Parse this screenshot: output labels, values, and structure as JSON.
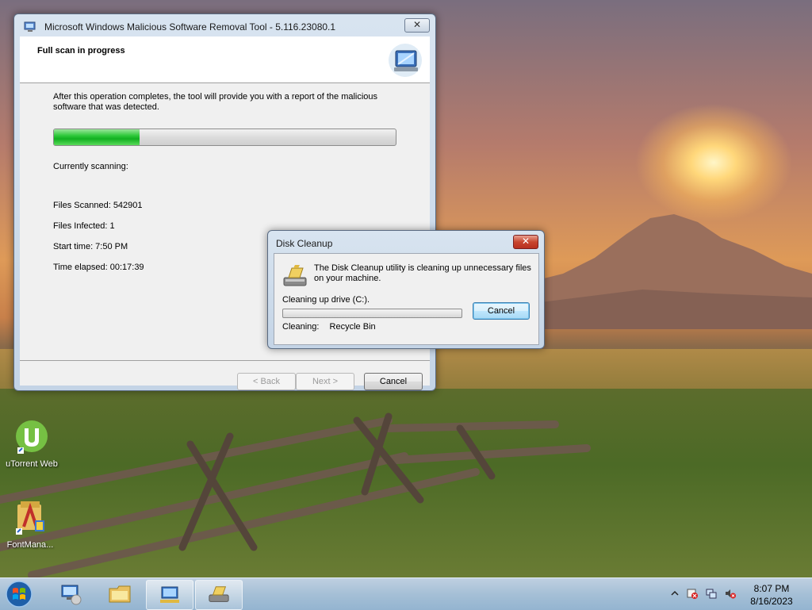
{
  "msrt": {
    "title": "Microsoft Windows Malicious Software Removal Tool - 5.116.23080.1",
    "close_symbol": "✕",
    "header_title": "Full scan in progress",
    "description": "After this operation completes, the tool will provide you with a report of the malicious software that was detected.",
    "progress_fraction": 0.25,
    "currently_scanning": "Currently scanning:",
    "files_scanned": "Files Scanned: 542901",
    "files_infected": "Files Infected: 1",
    "start_time": "Start time: 7:50 PM",
    "time_elapsed": "Time elapsed: 00:17:39",
    "back_label": "< Back",
    "next_label": "Next >",
    "cancel_label": "Cancel"
  },
  "disk_cleanup": {
    "title": "Disk Cleanup",
    "close_symbol": "✕",
    "message": "The Disk Cleanup utility is cleaning up unnecessary files on your machine.",
    "drive_text": "Cleaning up drive  (C:).",
    "cancel_label": "Cancel",
    "cleaning_label": "Cleaning:",
    "cleaning_item": "Recycle Bin",
    "progress_fraction": 0.0
  },
  "desktop": {
    "icons": [
      {
        "label": "uTorrent Web",
        "icon": "utorrent-icon"
      },
      {
        "label": "FontMana...",
        "icon": "font-manager-icon"
      }
    ]
  },
  "taskbar": {
    "time": "8:07 PM",
    "date": "8/16/2023"
  },
  "colors": {
    "progress_green": "#11b020",
    "utorrent_green": "#76c043"
  }
}
